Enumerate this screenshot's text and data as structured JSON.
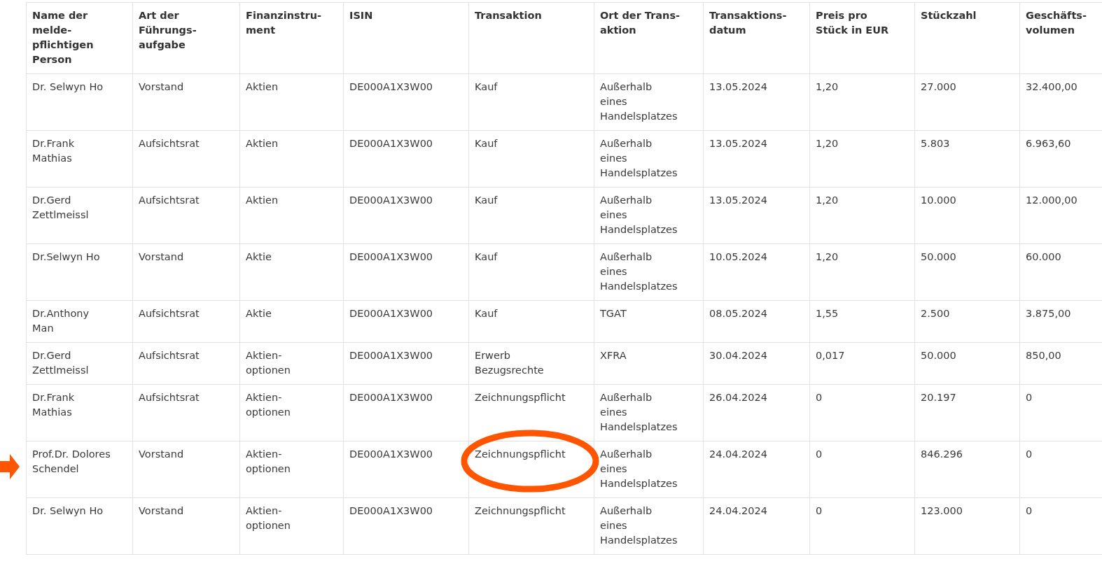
{
  "table": {
    "columns": [
      "Name der melde-pflichtigen Person",
      "Art der Führungs-aufgabe",
      "Finanzinstru-ment",
      "ISIN",
      "Transaktion",
      "Ort der Trans-aktion",
      "Transaktions-datum",
      "Preis pro Stück in EUR",
      "Stückzahl",
      "Geschäfts-volumen"
    ],
    "rows": [
      {
        "highlighted": false,
        "cells": [
          "Dr. Selwyn Ho",
          "Vorstand",
          "Aktien",
          "DE000A1X3W00",
          "Kauf",
          "Außerhalb eines Handelsplatzes",
          "13.05.2024",
          "1,20",
          "27.000",
          "32.400,00"
        ]
      },
      {
        "highlighted": false,
        "cells": [
          "Dr.Frank Mathias",
          "Aufsichtsrat",
          "Aktien",
          "DE000A1X3W00",
          "Kauf",
          "Außerhalb eines Handelsplatzes",
          "13.05.2024",
          "1,20",
          "5.803",
          "6.963,60"
        ]
      },
      {
        "highlighted": false,
        "cells": [
          "Dr.Gerd Zettlmeissl",
          "Aufsichtsrat",
          "Aktien",
          "DE000A1X3W00",
          "Kauf",
          "Außerhalb eines Handelsplatzes",
          "13.05.2024",
          "1,20",
          "10.000",
          "12.000,00"
        ]
      },
      {
        "highlighted": false,
        "cells": [
          "Dr.Selwyn Ho",
          "Vorstand",
          "Aktie",
          "DE000A1X3W00",
          "Kauf",
          "Außerhalb eines Handelsplatzes",
          "10.05.2024",
          "1,20",
          "50.000",
          "60.000"
        ]
      },
      {
        "highlighted": false,
        "cells": [
          "Dr.Anthony Man",
          "Aufsichtsrat",
          "Aktie",
          "DE000A1X3W00",
          "Kauf",
          "TGAT",
          "08.05.2024",
          "1,55",
          "2.500",
          "3.875,00"
        ]
      },
      {
        "highlighted": false,
        "cells": [
          "Dr.Gerd Zettlmeissl",
          "Aufsichtsrat",
          "Aktien-optionen",
          "DE000A1X3W00",
          "Erwerb Bezugsrechte",
          "XFRA",
          "30.04.2024",
          "0,017",
          "50.000",
          "850,00"
        ]
      },
      {
        "highlighted": false,
        "cells": [
          "Dr.Frank Mathias",
          "Aufsichtsrat",
          "Aktien-optionen",
          "DE000A1X3W00",
          "Zeichnungspflicht",
          "Außerhalb eines Handelsplatzes",
          "26.04.2024",
          "0",
          "20.197",
          "0"
        ]
      },
      {
        "highlighted": true,
        "cells": [
          "Prof.Dr. Dolores Schendel",
          "Vorstand",
          "Aktien-optionen",
          "DE000A1X3W00",
          "Zeichnungspflicht",
          "Außerhalb eines Handelsplatzes",
          "24.04.2024",
          "0",
          "846.296",
          "0"
        ]
      },
      {
        "highlighted": false,
        "cells": [
          "Dr. Selwyn Ho",
          "Vorstand",
          "Aktien-optionen",
          "DE000A1X3W00",
          "Zeichnungspflicht",
          "Außerhalb eines Handelsplatzes",
          "24.04.2024",
          "0",
          "123.000",
          "0"
        ]
      }
    ]
  }
}
